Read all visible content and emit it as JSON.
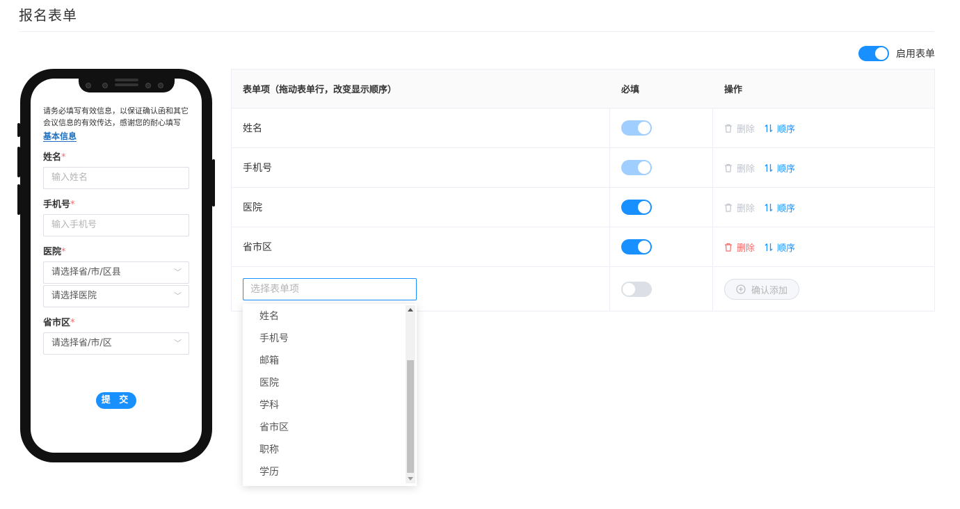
{
  "page": {
    "title": "报名表单"
  },
  "enable_form": {
    "label": "启用表单",
    "on": true
  },
  "phone_preview": {
    "intro": "请务必填写有效信息，以保证确认函和其它会议信息的有效传达，感谢您的耐心填写",
    "section": "基本信息",
    "fields": {
      "name": {
        "label": "姓名",
        "required_mark": "*",
        "placeholder": "输入姓名"
      },
      "phone": {
        "label": "手机号",
        "required_mark": "*",
        "placeholder": "输入手机号"
      },
      "hospital": {
        "label": "医院",
        "required_mark": "*",
        "select1": "请选择省/市/区县",
        "select2": "请选择医院"
      },
      "region": {
        "label": "省市区",
        "required_mark": "*",
        "select1": "请选择省/市/区"
      }
    },
    "submit": "提 交"
  },
  "table": {
    "headers": {
      "item": "表单项（拖动表单行，改变显示顺序）",
      "required": "必填",
      "action": "操作"
    },
    "rows": [
      {
        "name": "姓名",
        "required": true,
        "locked": true,
        "delete_label": "删除",
        "delete_enabled": false,
        "order_label": "顺序"
      },
      {
        "name": "手机号",
        "required": true,
        "locked": true,
        "delete_label": "删除",
        "delete_enabled": false,
        "order_label": "顺序"
      },
      {
        "name": "医院",
        "required": true,
        "locked": false,
        "delete_label": "删除",
        "delete_enabled": false,
        "order_label": "顺序"
      },
      {
        "name": "省市区",
        "required": true,
        "locked": false,
        "delete_label": "删除",
        "delete_enabled": true,
        "order_label": "顺序"
      }
    ],
    "add_row": {
      "select_placeholder": "选择表单项",
      "required": false,
      "confirm_label": "确认添加"
    }
  },
  "dropdown": {
    "options": [
      "姓名",
      "手机号",
      "邮箱",
      "医院",
      "学科",
      "省市区",
      "职称",
      "学历"
    ]
  },
  "colors": {
    "primary": "#1890ff",
    "danger": "#f56c6c",
    "muted": "#c0c4cc"
  }
}
